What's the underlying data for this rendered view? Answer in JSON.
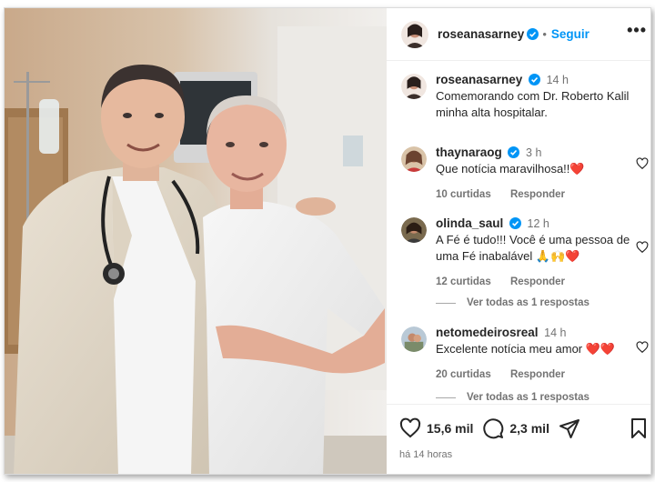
{
  "post": {
    "author": "roseanasarney",
    "follow_label": "Seguir",
    "more_label": "•••",
    "dot": "•",
    "caption": {
      "author": "roseanasarney",
      "time": "14 h",
      "text": "Comemorando com Dr. Roberto Kalil minha alta hospitalar."
    }
  },
  "comments": [
    {
      "author": "thaynaraog",
      "verified": true,
      "time": "3 h",
      "text": "Que notícia maravilhosa!!❤️",
      "likes": "10 curtidas",
      "reply_label": "Responder",
      "view_replies": ""
    },
    {
      "author": "olinda_saul",
      "verified": true,
      "time": "12 h",
      "text": "A Fé é tudo!!! Você é uma pessoa de uma Fé inabalável 🙏🙌❤️",
      "likes": "12 curtidas",
      "reply_label": "Responder",
      "view_replies": "Ver todas as 1 respostas"
    },
    {
      "author": "netomedeirosreal",
      "verified": false,
      "time": "14 h",
      "text": "Excelente notícia meu amor ❤️❤️",
      "likes": "20 curtidas",
      "reply_label": "Responder",
      "view_replies": "Ver todas as 1 respostas"
    }
  ],
  "actions": {
    "likes": "15,6 mil",
    "comments": "2,3 mil",
    "posted": "há 14 horas"
  },
  "colors": {
    "link_blue": "#0095f6",
    "verified_blue": "#0095f6",
    "muted": "#737373",
    "text": "#262626"
  },
  "icons": [
    "verified-icon",
    "more-icon",
    "heart-icon",
    "comment-icon",
    "share-icon",
    "bookmark-icon"
  ]
}
